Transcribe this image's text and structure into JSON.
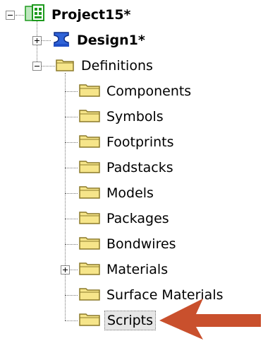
{
  "tree": {
    "project": {
      "label": "Project15*",
      "icon": "project-icon"
    },
    "design": {
      "label": "Design1*",
      "icon": "design-icon"
    },
    "definitions": {
      "label": "Definitions",
      "icon": "folder-open-icon"
    },
    "children": [
      {
        "label": "Components"
      },
      {
        "label": "Symbols"
      },
      {
        "label": "Footprints"
      },
      {
        "label": "Padstacks"
      },
      {
        "label": "Models"
      },
      {
        "label": "Packages"
      },
      {
        "label": "Bondwires"
      },
      {
        "label": "Materials"
      },
      {
        "label": "Surface Materials"
      },
      {
        "label": "Scripts"
      }
    ],
    "selected": "Scripts"
  },
  "annotation": {
    "arrow_color": "#c9502d",
    "points_to": "Scripts"
  },
  "colors": {
    "folder_fill": "#f6e58a",
    "folder_stroke": "#8c7a2a",
    "project_green": "#1e9a1e",
    "design_blue": "#1f4fc7"
  }
}
